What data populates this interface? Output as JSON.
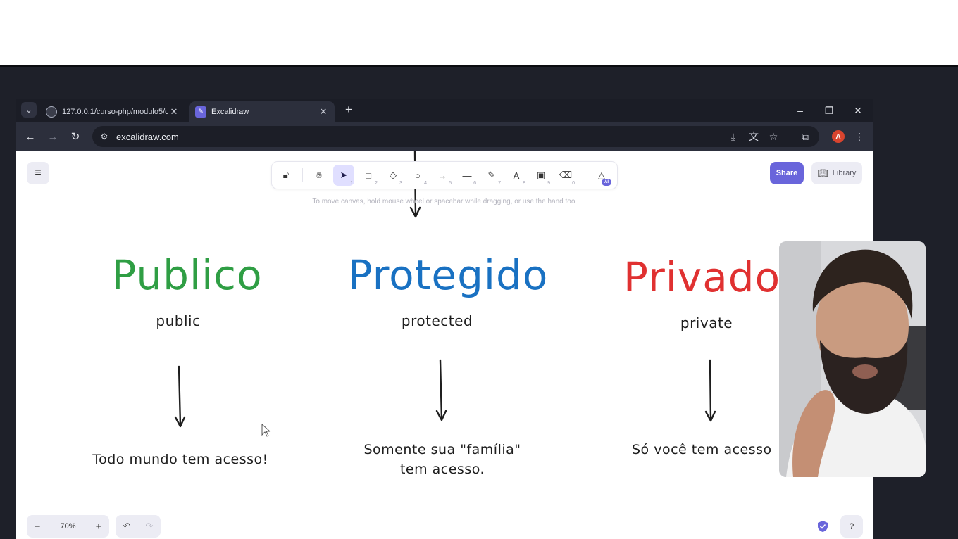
{
  "browser": {
    "tabs": [
      {
        "title": "127.0.0.1/curso-php/modulo5/c",
        "icon": "globe-icon",
        "active": false
      },
      {
        "title": "Excalidraw",
        "icon": "excalidraw-icon",
        "active": true
      }
    ],
    "new_tab": "+",
    "window_controls": {
      "minimize": "–",
      "restore": "❐",
      "close": "✕"
    },
    "url": "excalidraw.com",
    "avatar_letter": "A"
  },
  "excalidraw": {
    "toolbar_keys": [
      "1",
      "2",
      "3",
      "4",
      "5",
      "6",
      "7",
      "8",
      "9",
      "0"
    ],
    "ai_badge": "AI",
    "hint": "To move canvas, hold mouse wheel or spacebar while dragging, or use the hand tool",
    "share_label": "Share",
    "library_label": "Library",
    "zoom_level": "70%",
    "accent_color": "#6965db"
  },
  "drawing": {
    "columns": [
      {
        "title": "Publico",
        "subtitle": "public",
        "description_line1": "Todo mundo tem acesso!",
        "description_line2": "",
        "color": "#2f9e44"
      },
      {
        "title": "Protegido",
        "subtitle": "protected",
        "description_line1": "Somente sua \"família\"",
        "description_line2": "tem acesso.",
        "color": "#1971c2"
      },
      {
        "title": "Privado",
        "subtitle": "private",
        "description_line1": "Só você tem acesso",
        "description_line2": "",
        "color": "#e03131"
      }
    ]
  }
}
